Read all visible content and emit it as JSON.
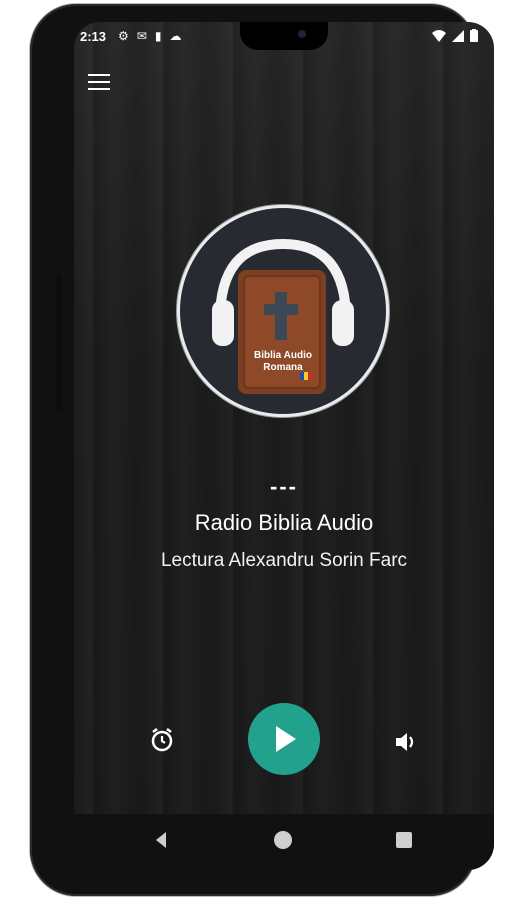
{
  "statusbar": {
    "time": "2:13"
  },
  "player": {
    "art_text_line1": "Biblia Audio",
    "art_text_line2": "Romana",
    "track_title": "---",
    "station_name": "Radio Biblia Audio",
    "subtitle": "Lectura Alexandru Sorin Farc",
    "play_color": "#22a28d"
  },
  "icons": {
    "menu": "menu-icon",
    "alarm": "alarm-icon",
    "play": "play-icon",
    "volume": "volume-icon",
    "back": "back-icon",
    "home": "home-icon",
    "recent": "recent-apps-icon"
  }
}
